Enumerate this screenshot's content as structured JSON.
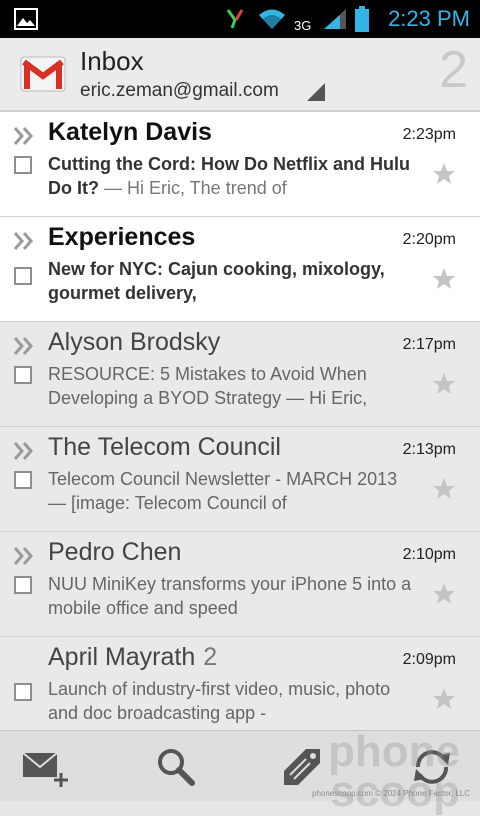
{
  "status_bar": {
    "time": "2:23 PM",
    "network": "3G",
    "icons": [
      "picture-icon",
      "bluetooth-signal-icon",
      "wifi-icon",
      "cell-signal-icon",
      "battery-icon"
    ],
    "time_color": "#35b5e5"
  },
  "header": {
    "title": "Inbox",
    "account": "eric.zeman@gmail.com",
    "unread_count": "2",
    "logo_icon": "gmail-logo-icon"
  },
  "messages": [
    {
      "sender": "Katelyn Davis",
      "time": "2:23pm",
      "subject": "Cutting the Cord: How Do Netflix and Hulu Do It?",
      "preview": " — Hi Eric, The trend of",
      "unread": true,
      "count": ""
    },
    {
      "sender": "Experiences",
      "time": "2:20pm",
      "subject": "New for NYC: Cajun cooking, mixology,  gourmet delivery,",
      "preview": "",
      "unread": true,
      "count": ""
    },
    {
      "sender": "Alyson Brodsky",
      "time": "2:17pm",
      "subject": "RESOURCE: 5 Mistakes to Avoid When Developing a BYOD Strategy",
      "preview": " — Hi Eric,",
      "unread": false,
      "count": ""
    },
    {
      "sender": "The Telecom Council",
      "time": "2:13pm",
      "subject": "Telecom Council Newsletter - MARCH 2013",
      "preview": " — [image: Telecom Council of",
      "unread": false,
      "count": ""
    },
    {
      "sender": "Pedro Chen",
      "time": "2:10pm",
      "subject": "NUU MiniKey transforms your iPhone 5 into a mobile office and speed",
      "preview": "",
      "unread": false,
      "count": ""
    },
    {
      "sender": "April Mayrath",
      "time": "2:09pm",
      "subject": "Launch of industry-first video, music, photo and doc broadcasting app -",
      "preview": "",
      "unread": false,
      "count": "2"
    }
  ],
  "action_bar": {
    "icons": [
      "compose-icon",
      "search-icon",
      "labels-icon",
      "refresh-icon"
    ]
  },
  "watermark": {
    "line1": "phone",
    "line2": "scoop",
    "footer": "phonescoop.com  © 2024 Phone Factor, LLC"
  }
}
